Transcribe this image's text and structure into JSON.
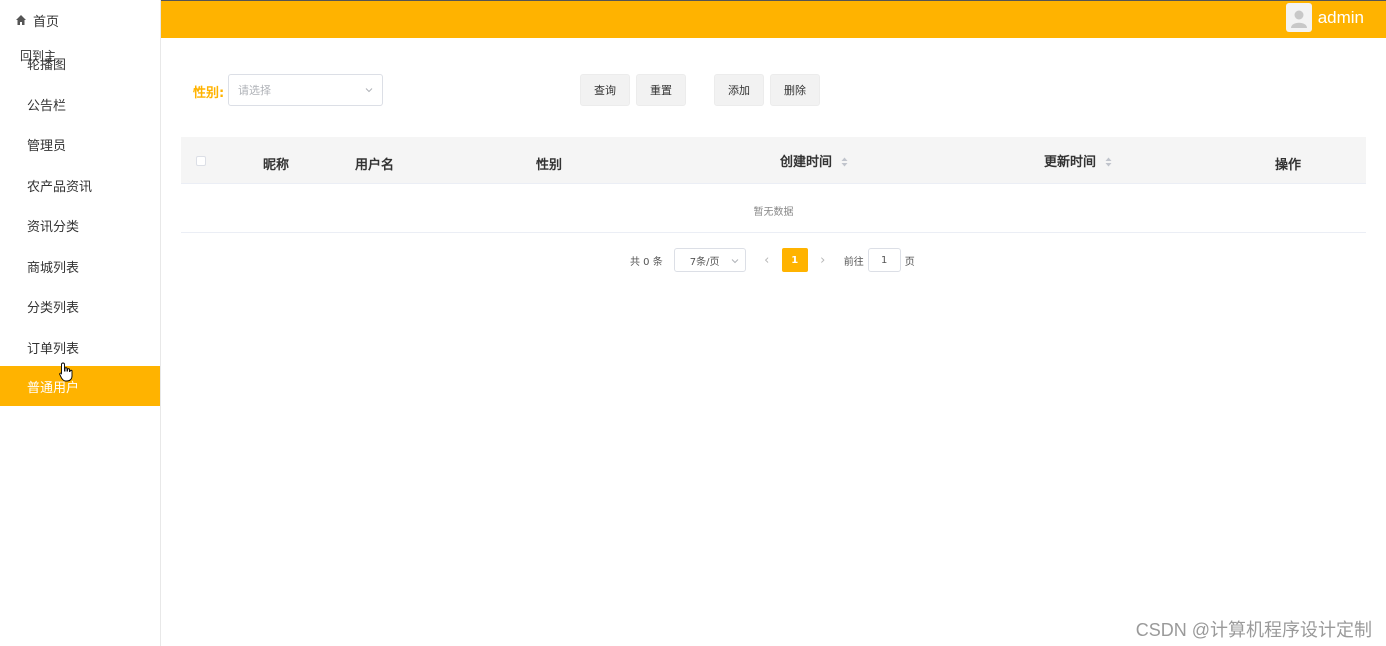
{
  "colors": {
    "accent": "#ffb300",
    "header_bg": "#ffb300",
    "active_item_bg": "#ffb300"
  },
  "sidebar": {
    "home": {
      "label": "首页",
      "icon": "home-icon"
    },
    "overlap_text": "回到主",
    "items": [
      {
        "label": "轮播图"
      },
      {
        "label": "公告栏"
      },
      {
        "label": "管理员"
      },
      {
        "label": "农产品资讯"
      },
      {
        "label": "资讯分类"
      },
      {
        "label": "商城列表"
      },
      {
        "label": "分类列表"
      },
      {
        "label": "订单列表"
      },
      {
        "label": "普通用户",
        "active": true
      }
    ]
  },
  "header": {
    "username": "admin",
    "avatar_icon": "user-avatar-icon"
  },
  "filter": {
    "label": "性别:",
    "select_placeholder": "请选择",
    "buttons": {
      "query": "查询",
      "reset": "重置",
      "add": "添加",
      "delete": "删除"
    }
  },
  "table": {
    "columns": [
      "昵称",
      "用户名",
      "性别",
      "创建时间",
      "更新时间",
      "操作"
    ],
    "sortable": [
      "创建时间",
      "更新时间"
    ],
    "empty_text": "暂无数据"
  },
  "pagination": {
    "total_text": "共 0 条",
    "page_size": "7条/页",
    "current_page": "1",
    "goto_label": "前往",
    "goto_value": "1",
    "page_suffix": "页"
  },
  "watermark": "CSDN @计算机程序设计定制"
}
